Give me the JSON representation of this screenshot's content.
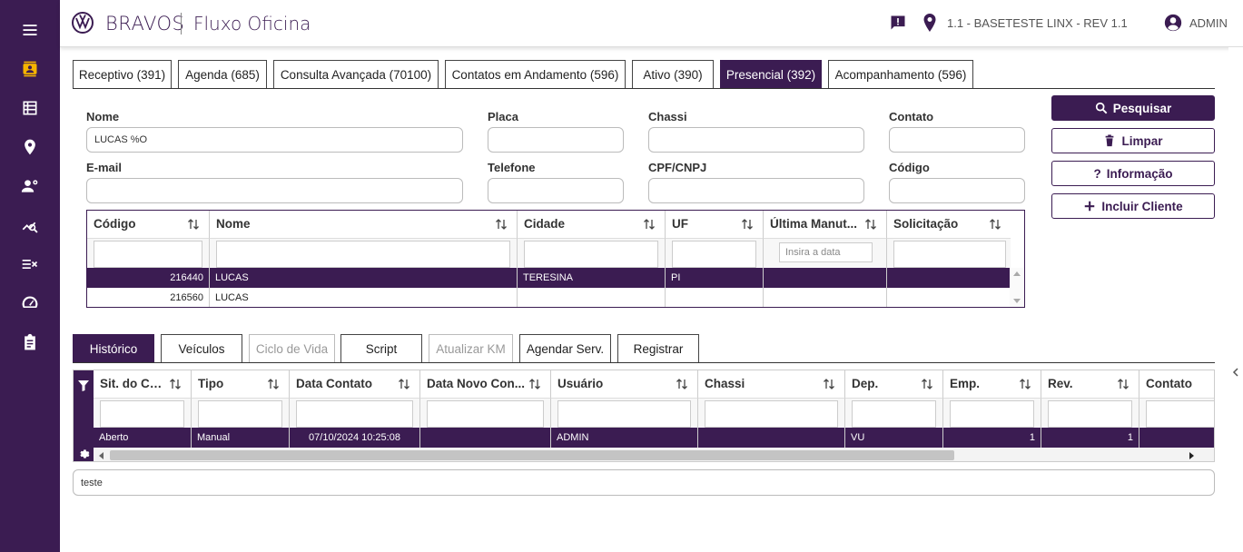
{
  "header": {
    "brand": "BRAVOS",
    "app_title": "Fluxo Oficina",
    "location": "1.1 - BASETESTE LINX - REV 1.1",
    "user": "ADMIN"
  },
  "top_tabs": [
    {
      "label": "Receptivo (391)",
      "active": false
    },
    {
      "label": "Agenda (685)",
      "active": false
    },
    {
      "label": "Consulta Avançada (70100)",
      "active": false
    },
    {
      "label": "Contatos em Andamento (596)",
      "active": false
    },
    {
      "label": "Ativo (390)",
      "active": false
    },
    {
      "label": "Presencial (392)",
      "active": true
    },
    {
      "label": "Acompanhamento (596)",
      "active": false
    }
  ],
  "form": {
    "nome_label": "Nome",
    "nome_value": "LUCAS %O",
    "placa_label": "Placa",
    "placa_value": "",
    "chassi_label": "Chassi",
    "chassi_value": "",
    "contato_label": "Contato",
    "contato_value": "",
    "email_label": "E-mail",
    "email_value": "",
    "telefone_label": "Telefone",
    "telefone_value": "",
    "cpf_label": "CPF/CNPJ",
    "cpf_value": "",
    "codigo_label": "Código",
    "codigo_value": ""
  },
  "actions": {
    "pesquisar": "Pesquisar",
    "limpar": "Limpar",
    "informacao": "Informação",
    "incluir": "Incluir Cliente"
  },
  "client_grid": {
    "columns": [
      "Código",
      "Nome",
      "Cidade",
      "UF",
      "Última Manut...",
      "Solicitação"
    ],
    "date_placeholder": "Insira a data",
    "rows": [
      {
        "codigo": "216440",
        "nome": "LUCAS",
        "cidade": "TERESINA",
        "uf": "PI",
        "ultima": "",
        "solicitacao": "",
        "selected": true
      },
      {
        "codigo": "216560",
        "nome": "LUCAS",
        "cidade": "",
        "uf": "",
        "ultima": "",
        "solicitacao": "",
        "selected": false
      }
    ]
  },
  "bottom_tabs": [
    {
      "label": "Histórico",
      "state": "active"
    },
    {
      "label": "Veículos",
      "state": "normal"
    },
    {
      "label": "Ciclo de Vida",
      "state": "disabled"
    },
    {
      "label": "Script",
      "state": "normal"
    },
    {
      "label": "Atualizar KM",
      "state": "disabled"
    },
    {
      "label": "Agendar Serv.",
      "state": "normal"
    },
    {
      "label": "Registrar",
      "state": "normal"
    }
  ],
  "history_grid": {
    "columns": [
      "Sit. do Co...",
      "Tipo",
      "Data Contato",
      "Data Novo Con...",
      "Usuário",
      "Chassi",
      "Dep.",
      "Emp.",
      "Rev.",
      "Contato"
    ],
    "rows": [
      {
        "sit": "Aberto",
        "tipo": "Manual",
        "data": "07/10/2024 10:25:08",
        "data_novo": "",
        "usuario": "ADMIN",
        "chassi": "",
        "dep": "VU",
        "emp": "1",
        "rev": "1",
        "contato": ""
      }
    ]
  },
  "notes": "teste",
  "colors": {
    "primary": "#3b1c52",
    "accent": "#f5b400"
  }
}
